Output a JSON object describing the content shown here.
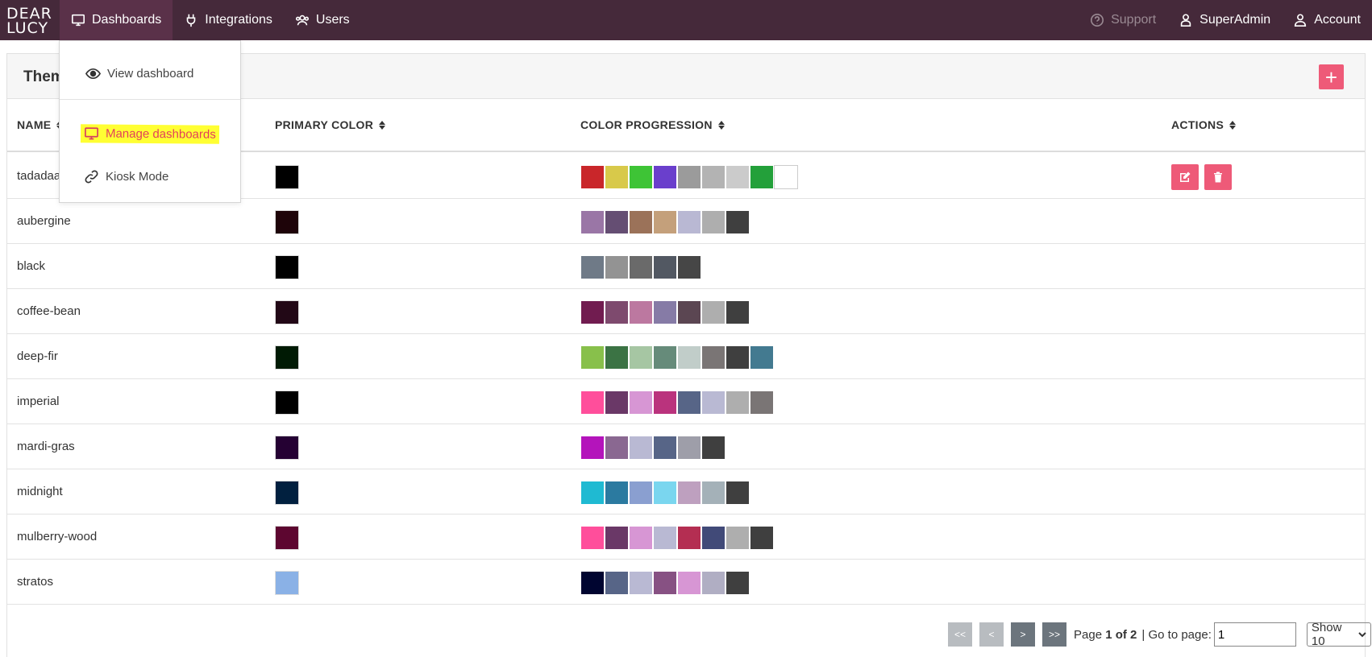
{
  "nav": {
    "logo_line1": "DEAR",
    "logo_line2": "LUCY",
    "dashboards": "Dashboards",
    "integrations": "Integrations",
    "users": "Users",
    "support": "Support",
    "superadmin": "SuperAdmin",
    "account": "Account"
  },
  "dropdown": {
    "view": "View dashboard",
    "manage": "Manage dashboards",
    "kiosk": "Kiosk Mode"
  },
  "panel": {
    "title": "Them"
  },
  "table": {
    "headers": {
      "name": "NAME",
      "primary": "PRIMARY COLOR",
      "progression": "COLOR PROGRESSION",
      "actions": "ACTIONS"
    },
    "rows": [
      {
        "name": "tadadaa",
        "primary": "#000000",
        "progression": [
          "#c9262a",
          "#d8c94a",
          "#3ec436",
          "#6a3fcc",
          "#9b9b9b",
          "#b3b3b3",
          "#cbcbcb",
          "#23a03a",
          "#ffffff"
        ]
      },
      {
        "name": "aubergine",
        "primary": "#1e0409",
        "progression": [
          "#9a76a6",
          "#654e73",
          "#9b7259",
          "#c4a07b",
          "#b9b8d3",
          "#aeaeae",
          "#3f3f3f"
        ]
      },
      {
        "name": "black",
        "primary": "#000000",
        "progression": [
          "#6f7a87",
          "#939393",
          "#6a6a6a",
          "#525862",
          "#464646"
        ]
      },
      {
        "name": "coffee-bean",
        "primary": "#220816",
        "progression": [
          "#711c50",
          "#7e4a6e",
          "#bc78a0",
          "#867ba6",
          "#5b4652",
          "#aeaeae",
          "#3f3f3f"
        ]
      },
      {
        "name": "deep-fir",
        "primary": "#001a04",
        "progression": [
          "#88c04b",
          "#3b7344",
          "#a6c6a3",
          "#668b7a",
          "#c1cdc9",
          "#7a7575",
          "#3f3f3f",
          "#437a90"
        ]
      },
      {
        "name": "imperial",
        "primary": "#000000",
        "progression": [
          "#ff4e9b",
          "#6a3867",
          "#d796d4",
          "#ba337d",
          "#576587",
          "#b9b9d3",
          "#aeaeae",
          "#7a7575"
        ]
      },
      {
        "name": "mardi-gras",
        "primary": "#250133",
        "progression": [
          "#b414bb",
          "#8a6891",
          "#b9b9d3",
          "#576587",
          "#9e9ea9",
          "#3f3f3f"
        ]
      },
      {
        "name": "midnight",
        "primary": "#01203f",
        "progression": [
          "#1fbad2",
          "#2b7aa0",
          "#8a9fd0",
          "#7ad6ef",
          "#bea0bf",
          "#a4b1b8",
          "#3f3f3f"
        ]
      },
      {
        "name": "mulberry-wood",
        "primary": "#5d0630",
        "progression": [
          "#ff4e9b",
          "#6a3867",
          "#d796d4",
          "#b9b9d3",
          "#b42e52",
          "#414a78",
          "#aeaeae",
          "#3f3f3f"
        ]
      },
      {
        "name": "stratos",
        "primary": "#8ab1e6",
        "progression": [
          "#000530",
          "#576587",
          "#b9b9d3",
          "#875183",
          "#d796d4",
          "#b0aec3",
          "#3f3f3f"
        ]
      }
    ]
  },
  "pager": {
    "first": "<<",
    "prev": "<",
    "next": ">",
    "last": ">>",
    "page_prefix": "Page",
    "page_current": "1 of 2",
    "goto_label": "| Go to page:",
    "goto_value": "1",
    "show": "Show 10"
  },
  "colors": {
    "nav_bg": "#45293a",
    "accent": "#ee5a78"
  }
}
